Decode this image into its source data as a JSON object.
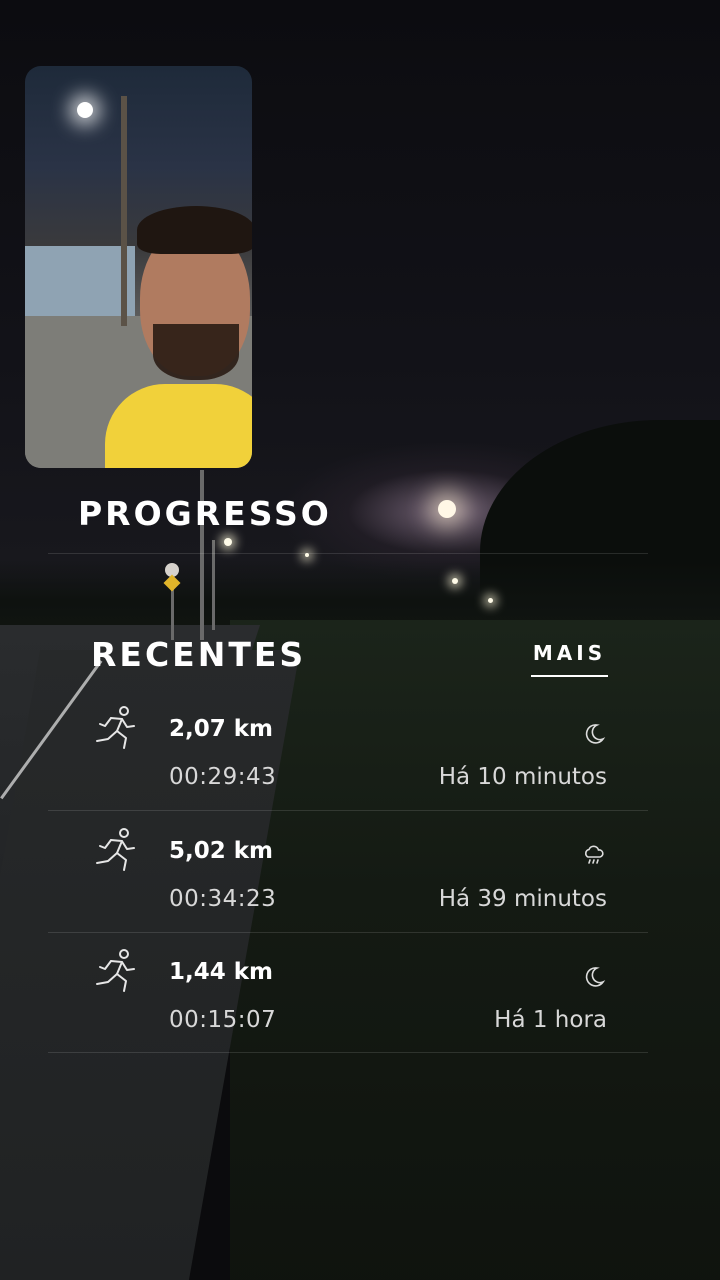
{
  "progress": {
    "title": "PROGRESSO"
  },
  "recents": {
    "title": "RECENTES",
    "more_label": "MAIS",
    "items": [
      {
        "distance": "2,07 km",
        "duration": "00:29:43",
        "ago": "Há 10 minutos",
        "activity_icon": "running-icon",
        "weather_icon": "moon-icon"
      },
      {
        "distance": "5,02 km",
        "duration": "00:34:23",
        "ago": "Há 39 minutos",
        "activity_icon": "running-icon",
        "weather_icon": "rain-cloud-icon"
      },
      {
        "distance": "1,44 km",
        "duration": "00:15:07",
        "ago": "Há 1 hora",
        "activity_icon": "running-icon",
        "weather_icon": "moon-icon"
      }
    ]
  },
  "colors": {
    "text": "#ffffff",
    "secondary_text": "#d8d8d8",
    "selfie_shirt": "#f1d13a"
  }
}
